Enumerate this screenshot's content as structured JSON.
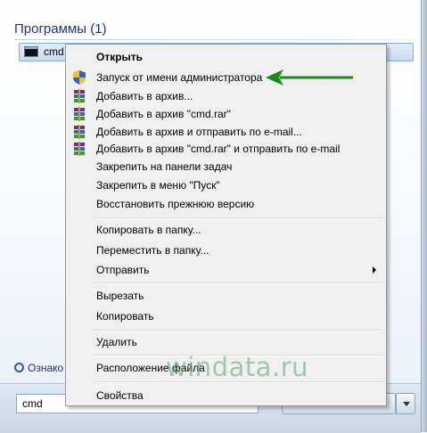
{
  "start_menu": {
    "section_title": "Программы (1)",
    "result_label": "cmd",
    "more_results": "Ознако",
    "search_value": "cmd"
  },
  "context_menu": {
    "items": [
      {
        "label": "Открыть",
        "bold": true,
        "icon": null
      },
      {
        "label": "Запуск от имени администратора",
        "icon": "uac-shield-icon"
      },
      {
        "label": "Добавить в архив...",
        "icon": "winrar-icon"
      },
      {
        "label": "Добавить в архив \"cmd.rar\"",
        "icon": "winrar-icon"
      },
      {
        "label": "Добавить в архив и отправить по e-mail...",
        "icon": "winrar-icon"
      },
      {
        "label": "Добавить в архив \"cmd.rar\" и отправить по e-mail",
        "icon": "winrar-icon"
      },
      {
        "label": "Закрепить на панели задач",
        "icon": null
      },
      {
        "label": "Закрепить в меню \"Пуск\"",
        "icon": null
      },
      {
        "label": "Восстановить прежнюю версию",
        "icon": null
      },
      {
        "label": "Копировать в папку...",
        "icon": null
      },
      {
        "label": "Переместить в папку...",
        "icon": null
      },
      {
        "label": "Отправить",
        "icon": null,
        "submenu": true
      },
      {
        "label": "Вырезать",
        "icon": null
      },
      {
        "label": "Копировать",
        "icon": null
      },
      {
        "label": "Удалить",
        "icon": null
      },
      {
        "label": "Расположение файла",
        "icon": null
      },
      {
        "label": "Свойства",
        "icon": null
      }
    ]
  },
  "watermark": "windata.ru",
  "colors": {
    "title": "#1e3287",
    "arrow": "#1a8a1a",
    "watermark": "#5aa578"
  }
}
